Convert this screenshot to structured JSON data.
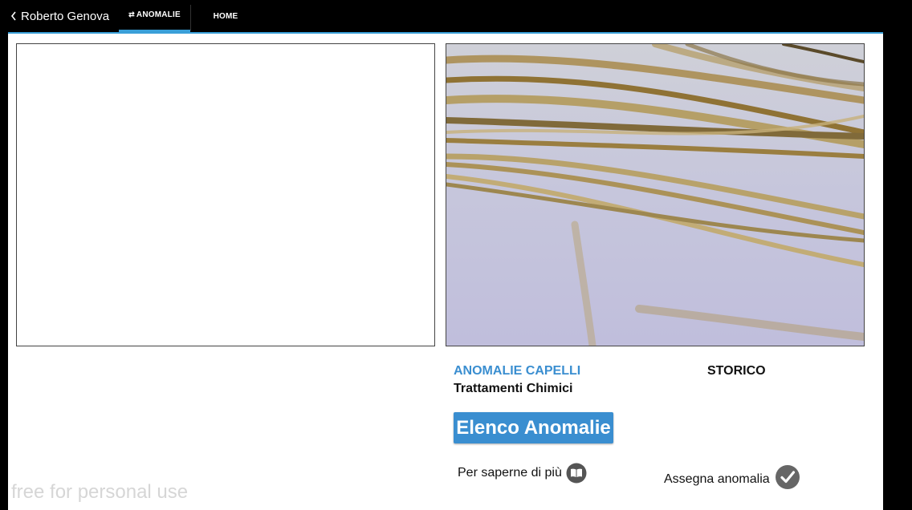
{
  "header": {
    "back_icon": "chevron-left-icon",
    "user_name": "Roberto Genova",
    "tabs": [
      {
        "label": "ANOMALIE",
        "icon": "refresh-icon",
        "active": true
      },
      {
        "label": "HOME",
        "active": false
      }
    ],
    "accent_color": "#3a9fd8"
  },
  "main": {
    "section_title": "ANOMALIE CAPELLI",
    "section_subtitle": "Trattamenti Chimici",
    "storico_label": "STORICO",
    "list_button_label": "Elenco Anomalie",
    "learn_more_label": "Per saperne di più",
    "learn_more_icon": "book-icon",
    "assign_label": "Assegna anomalia",
    "assign_icon": "check-circle-icon",
    "title_color": "#3a8ed0"
  },
  "watermark": "free for personal use"
}
